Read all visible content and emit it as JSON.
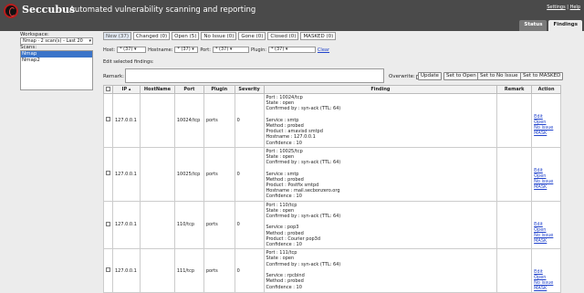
{
  "header": {
    "app_name": "Seccubus",
    "tagline": "Automated vulnerability scanning and reporting",
    "links": [
      "Settings",
      "Help"
    ],
    "tabs": [
      "Status",
      "Findings"
    ]
  },
  "sidebar": {
    "workspace_label": "Workspace:",
    "workspace_value": "Nmap · 2 scan(s) - Last 20",
    "scans_label": "Scans:",
    "scans": [
      "Nmap",
      "Nmap2"
    ]
  },
  "filter_tabs": [
    "New (37)",
    "Changed (0)",
    "Open (5)",
    "No Issue (0)",
    "Gone (0)",
    "Closed (0)",
    "MASKED (0)"
  ],
  "filters": {
    "host_label": "Host:",
    "host_value": "* (37)",
    "hostname_label": "Hostname:",
    "hostname_value": "* (37)",
    "port_label": "Port:",
    "port_value": "* (37)",
    "plugin_label": "Plugin:",
    "plugin_value": "* (37)",
    "clear": "Clear"
  },
  "edit": {
    "label": "Edit selected findings:",
    "remark_label": "Remark:",
    "overwrite_label": "Overwrite:",
    "buttons": [
      "Update",
      "Set to Open",
      "Set to No Issue",
      "Set to MASKED"
    ]
  },
  "table": {
    "columns": [
      "IP",
      "HostName",
      "Port",
      "Plugin",
      "Severity",
      "Finding",
      "Remark",
      "Action"
    ],
    "rows": [
      {
        "ip": "127.0.0.1",
        "hostname": "",
        "port": "10024/tcp",
        "plugin": "ports",
        "severity": "0",
        "finding": [
          "Port : 10024/tcp",
          "State : open",
          "Confirmed by : syn-ack (TTL: 64)",
          "",
          "Service : smtp",
          "Method : probed",
          "Product : amavisd smtpd",
          "Hostname : 127.0.0.1",
          "Confidence : 10"
        ],
        "actions": [
          "Edit",
          "Open",
          "No issue",
          "MASK"
        ]
      },
      {
        "ip": "127.0.0.1",
        "hostname": "",
        "port": "10025/tcp",
        "plugin": "ports",
        "severity": "0",
        "finding": [
          "Port : 10025/tcp",
          "State : open",
          "Confirmed by : syn-ack (TTL: 64)",
          "",
          "Service : smtp",
          "Method : probed",
          "Product : Postfix smtpd",
          "Hostname : mail.secbonzero.org",
          "Confidence : 10"
        ],
        "actions": [
          "Edit",
          "Open",
          "No issue",
          "MASK"
        ]
      },
      {
        "ip": "127.0.0.1",
        "hostname": "",
        "port": "110/tcp",
        "plugin": "ports",
        "severity": "0",
        "finding": [
          "Port : 110/tcp",
          "State : open",
          "Confirmed by : syn-ack (TTL: 64)",
          "",
          "Service : pop3",
          "Method : probed",
          "Product : Courier pop3d",
          "Confidence : 10"
        ],
        "actions": [
          "Edit",
          "Open",
          "No issue",
          "MASK"
        ]
      },
      {
        "ip": "127.0.0.1",
        "hostname": "",
        "port": "111/tcp",
        "plugin": "ports",
        "severity": "0",
        "finding": [
          "Port : 111/tcp",
          "State : open",
          "Confirmed by : syn-ack (TTL: 64)",
          "",
          "Service : rpcbind",
          "Method : probed",
          "Confidence : 10"
        ],
        "actions": [
          "Edit",
          "Open",
          "No issue",
          "MASK"
        ]
      }
    ]
  },
  "colors": {
    "header_bg": "#4a4a4a",
    "logo_red": "#b81d1d",
    "link_blue": "#2244cc",
    "selection_blue": "#3a74c9"
  }
}
